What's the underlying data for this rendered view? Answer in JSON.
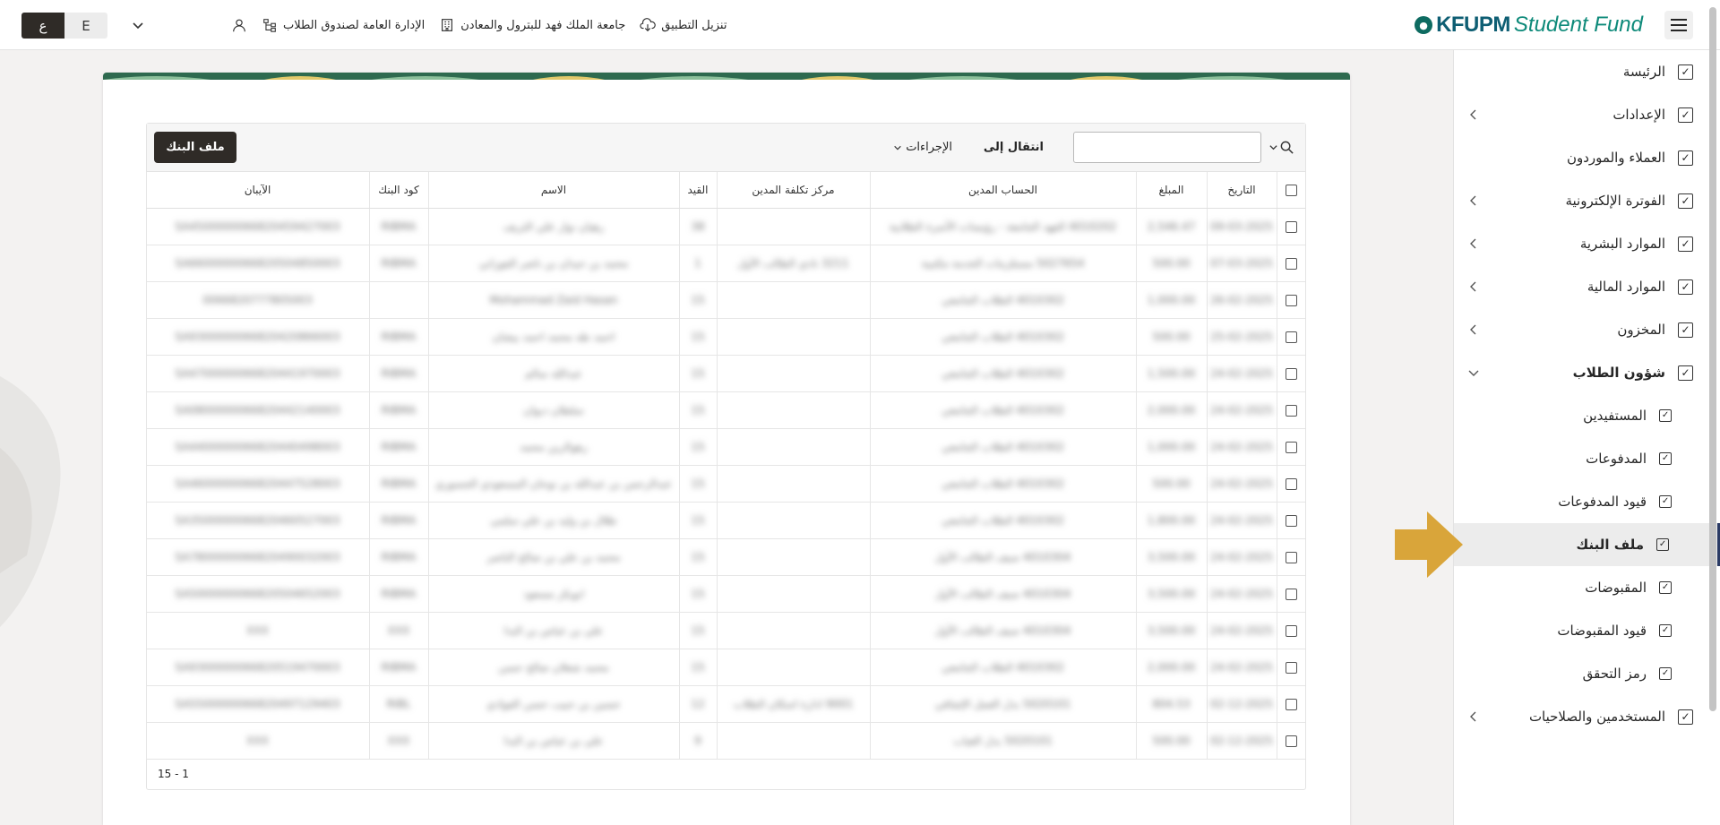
{
  "header": {
    "logo_bold": "KFUPM",
    "logo_light": "Student Fund",
    "links": [
      {
        "label": "تنزيل التطبيق",
        "icon": "cloud-download-icon"
      },
      {
        "label": "جامعة الملك فهد للبترول والمعادن",
        "icon": "building-icon"
      },
      {
        "label": "الإدارة العامة لصندوق الطلاب",
        "icon": "org-chart-icon"
      }
    ],
    "lang_ar": "ع",
    "lang_en": "E"
  },
  "sidebar": {
    "items": [
      {
        "label": "الرئيسة",
        "chevron": false
      },
      {
        "label": "الإعدادات",
        "chevron": true
      },
      {
        "label": "العملاء والموردون",
        "chevron": false
      },
      {
        "label": "الفوترة الإلكترونية",
        "chevron": true
      },
      {
        "label": "الموارد البشرية",
        "chevron": true
      },
      {
        "label": "الموارد المالية",
        "chevron": true
      },
      {
        "label": "المخزون",
        "chevron": true
      },
      {
        "label": "شؤون الطلاب",
        "chevron": true,
        "expanded": true
      },
      {
        "label": "المستفيدين",
        "sub": true
      },
      {
        "label": "المدفوعات",
        "sub": true
      },
      {
        "label": "قيود المدفوعات",
        "sub": true
      },
      {
        "label": "ملف البنك",
        "sub": true,
        "active": true
      },
      {
        "label": "المقبوضات",
        "sub": true
      },
      {
        "label": "قيود المقبوضات",
        "sub": true
      },
      {
        "label": "رمز التحقق",
        "sub": true
      },
      {
        "label": "المستخدمين والصلاحيات",
        "chevron": true
      }
    ]
  },
  "toolbar": {
    "search_placeholder": "",
    "goto_label": "انتقال إلى",
    "actions_label": "الإجراءات",
    "bank_file_button": "ملف البنك"
  },
  "table": {
    "columns": [
      "التاريخ",
      "المبلغ",
      "الحساب المدين",
      "مركز تكلفة المدين",
      "القيد",
      "الاسم",
      "كود البنك",
      "الآيبان"
    ],
    "rows": [
      [
        "09-03-2025",
        "2,546.47",
        "4010202 الفهد الجامعة - رؤيسات الأسرة الطلابية",
        "",
        "38",
        "رهيان نوار علي الثريف",
        "RIBMA",
        "SA4500000066820459427003"
      ],
      [
        "07-03-2025",
        "500.00",
        "5027654 مستلزمات الخدمة مكتبية",
        "3211 نادي الطالب الأول",
        "1",
        "محمد بن حيدان بن ناصر الفوزاني",
        "RIBMA",
        "SA6600000066820504850003"
      ],
      [
        "26-02-2025",
        "1,000.00",
        "4010302 الطلاب الجامعي",
        "",
        "15",
        "Mohammad Zaid Hasan",
        "",
        "0066820777805003"
      ],
      [
        "25-02-2025",
        "500.00",
        "4010302 الطلاب الجامعي",
        "",
        "15",
        "احمد طه محمد احمد بيشان",
        "RIBMA",
        "SA9300000066820420866003"
      ],
      [
        "24-02-2025",
        "1,500.00",
        "4010302 الطلاب الجامعي",
        "",
        "15",
        "عبدالله سالم",
        "RIBMA",
        "SA4700000066820441970003"
      ],
      [
        "24-02-2025",
        "2,000.00",
        "4010302 الطلاب الجامعي",
        "",
        "15",
        "سلطان دبوان",
        "RIBMA",
        "SA0800000066820442140003"
      ],
      [
        "24-02-2025",
        "1,000.00",
        "4010302 الطلاب الجامعي",
        "",
        "15",
        "رهوالرين محمد",
        "RIBMA",
        "SA4400000066820440498003"
      ],
      [
        "24-02-2025",
        "500.00",
        "4010302 الطلاب الجامعي",
        "",
        "15",
        "عبدالرحمن بن عبدالله بن نوحان المسعودي الجسوري",
        "RIBMA",
        "SA4600000066820447528003"
      ],
      [
        "24-02-2025",
        "1,800.00",
        "4010302 الطلاب الجامعي",
        "",
        "15",
        "طلال بن وليد بن علي سلمي",
        "RIBMA",
        "SA3500000066820460527003"
      ],
      [
        "24-02-2025",
        "3,500.00",
        "4010304 سيف الطالب الأول",
        "",
        "15",
        "محمد بن علي بن صالح الناصر",
        "RIBMA",
        "SA7800000066820490032003"
      ],
      [
        "24-02-2025",
        "3,500.00",
        "4010304 سيف الطالب الأول",
        "",
        "15",
        "ابوبكر مسعود",
        "RIBMA",
        "SA5000000066820504652003"
      ],
      [
        "24-02-2025",
        "3,500.00",
        "4010304 سيف الطالب الأول",
        "",
        "15",
        "علي بن عباس بن البدا",
        "XXX",
        "XXX"
      ],
      [
        "24-02-2025",
        "2,000.00",
        "4010302 الطلاب الجامعي",
        "",
        "15",
        "محمد شعلان صالح حسن",
        "RIBMA",
        "SA9300000066820519470003"
      ],
      [
        "02-12-2025",
        "804.53",
        "5020101 بدل العمل الإضافي",
        "9001 ادارة اسكان الطلاب",
        "12",
        "حسين بن حبيب حسن الفوادي",
        "RIBL",
        "SA5500000066820497129403"
      ],
      [
        "02-12-2025",
        "500.00",
        "5020101 بدل الغياب",
        "",
        "9",
        "علي بن عباس بن البدا",
        "XXX",
        "XXX"
      ]
    ]
  },
  "pagination": "15 - 1"
}
